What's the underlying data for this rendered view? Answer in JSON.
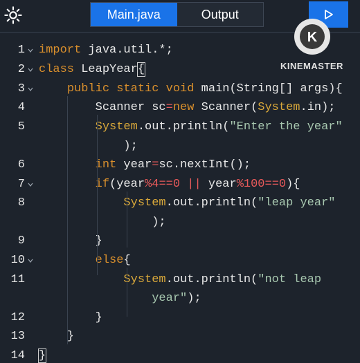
{
  "header": {
    "tabs": [
      {
        "label": "Main.java",
        "active": true
      },
      {
        "label": "Output",
        "active": false
      }
    ],
    "settings_icon": "gear-icon",
    "run_icon": "play-icon"
  },
  "watermark": {
    "logo_letter": "K",
    "text": "KINEMASTER"
  },
  "colors": {
    "accent": "#1a73e8",
    "background": "#1d232c",
    "keyword": "#d98f2c",
    "string": "#a8c8b0",
    "number": "#e85a5a",
    "system": "#d9a83a"
  },
  "editor": {
    "lines": [
      {
        "num": "1",
        "tokens": [
          {
            "t": "import",
            "c": "kw"
          },
          {
            "t": " java.util.*;",
            "c": "cls"
          }
        ]
      },
      {
        "num": "2",
        "tokens": [
          {
            "t": "class",
            "c": "kw"
          },
          {
            "t": " LeapYear",
            "c": "cls"
          },
          {
            "t": "{",
            "c": "cls"
          }
        ]
      },
      {
        "num": "3",
        "tokens": [
          {
            "t": "    "
          },
          {
            "t": "public",
            "c": "kw"
          },
          {
            "t": " "
          },
          {
            "t": "static",
            "c": "kw"
          },
          {
            "t": " "
          },
          {
            "t": "void",
            "c": "kw"
          },
          {
            "t": " main(String[] args){",
            "c": "cls"
          }
        ]
      },
      {
        "num": "4",
        "tokens": [
          {
            "t": "        Scanner sc",
            "c": "cls"
          },
          {
            "t": "=",
            "c": "op"
          },
          {
            "t": "new",
            "c": "kw"
          },
          {
            "t": " Scanner(",
            "c": "cls"
          },
          {
            "t": "System",
            "c": "sys"
          },
          {
            "t": ".in);",
            "c": "cls"
          }
        ]
      },
      {
        "num": "5",
        "tokens": [
          {
            "t": "        "
          },
          {
            "t": "System",
            "c": "sys"
          },
          {
            "t": ".out.println(",
            "c": "cls"
          },
          {
            "t": "\"Enter the year\"",
            "c": "str"
          }
        ]
      },
      {
        "num": "",
        "tokens": [
          {
            "t": "            );",
            "c": "cls"
          }
        ]
      },
      {
        "num": "6",
        "tokens": [
          {
            "t": "        "
          },
          {
            "t": "int",
            "c": "kw"
          },
          {
            "t": " year",
            "c": "cls"
          },
          {
            "t": "=",
            "c": "op"
          },
          {
            "t": "sc.nextInt();",
            "c": "cls"
          }
        ]
      },
      {
        "num": "7",
        "tokens": [
          {
            "t": "        "
          },
          {
            "t": "if",
            "c": "kw"
          },
          {
            "t": "(year",
            "c": "cls"
          },
          {
            "t": "%",
            "c": "op"
          },
          {
            "t": "4",
            "c": "num"
          },
          {
            "t": "==",
            "c": "op"
          },
          {
            "t": "0",
            "c": "num"
          },
          {
            "t": " ",
            "c": "cls"
          },
          {
            "t": "||",
            "c": "op"
          },
          {
            "t": " year",
            "c": "cls"
          },
          {
            "t": "%",
            "c": "op"
          },
          {
            "t": "100",
            "c": "num"
          },
          {
            "t": "==",
            "c": "op"
          },
          {
            "t": "0",
            "c": "num"
          },
          {
            "t": "){",
            "c": "cls"
          }
        ]
      },
      {
        "num": "8",
        "tokens": [
          {
            "t": "            "
          },
          {
            "t": "System",
            "c": "sys"
          },
          {
            "t": ".out.println(",
            "c": "cls"
          },
          {
            "t": "\"leap year\"",
            "c": "str"
          }
        ]
      },
      {
        "num": "",
        "tokens": [
          {
            "t": "                );",
            "c": "cls"
          }
        ]
      },
      {
        "num": "9",
        "tokens": [
          {
            "t": "        }",
            "c": "cls"
          }
        ]
      },
      {
        "num": "10",
        "tokens": [
          {
            "t": "        "
          },
          {
            "t": "else",
            "c": "kw"
          },
          {
            "t": "{",
            "c": "cls"
          }
        ]
      },
      {
        "num": "11",
        "tokens": [
          {
            "t": "            "
          },
          {
            "t": "System",
            "c": "sys"
          },
          {
            "t": ".out.println(",
            "c": "cls"
          },
          {
            "t": "\"not leap",
            "c": "str"
          }
        ]
      },
      {
        "num": "",
        "tokens": [
          {
            "t": "                "
          },
          {
            "t": "year\"",
            "c": "str"
          },
          {
            "t": ");",
            "c": "cls"
          }
        ]
      },
      {
        "num": "12",
        "tokens": [
          {
            "t": "        }",
            "c": "cls"
          }
        ]
      },
      {
        "num": "13",
        "tokens": [
          {
            "t": "    }",
            "c": "cls"
          }
        ]
      },
      {
        "num": "14",
        "tokens": [
          {
            "t": "}",
            "c": "cls"
          }
        ]
      }
    ]
  }
}
